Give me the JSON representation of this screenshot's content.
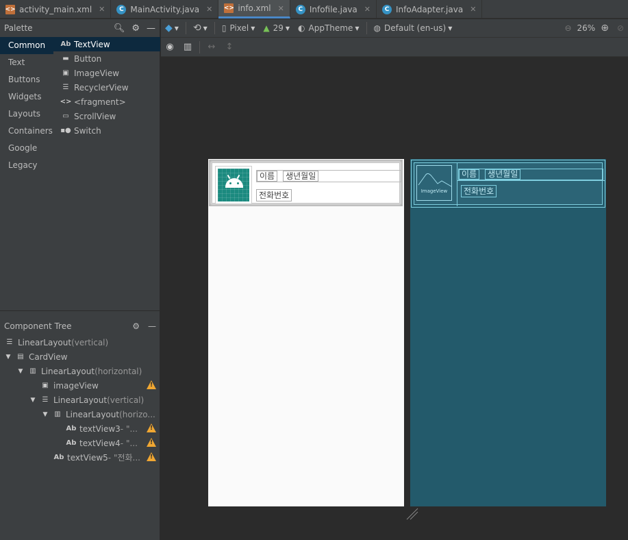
{
  "tabs": [
    {
      "label": "activity_main.xml",
      "kind": "xml",
      "active": false
    },
    {
      "label": "MainActivity.java",
      "kind": "java",
      "active": false
    },
    {
      "label": "info.xml",
      "kind": "xml",
      "active": true
    },
    {
      "label": "Infofile.java",
      "kind": "java",
      "active": false
    },
    {
      "label": "InfoAdapter.java",
      "kind": "java",
      "active": false
    }
  ],
  "palette": {
    "title": "Palette",
    "categories": [
      "Common",
      "Text",
      "Buttons",
      "Widgets",
      "Layouts",
      "Containers",
      "Google",
      "Legacy"
    ],
    "widgets": [
      {
        "icon": "Ab",
        "label": "TextView"
      },
      {
        "icon": "button-icon",
        "label": "Button"
      },
      {
        "icon": "image-icon",
        "label": "ImageView"
      },
      {
        "icon": "list-icon",
        "label": "RecyclerView"
      },
      {
        "icon": "code-icon",
        "label": "<fragment>"
      },
      {
        "icon": "scroll-icon",
        "label": "ScrollView"
      },
      {
        "icon": "switch-icon",
        "label": "Switch"
      }
    ]
  },
  "component_tree": {
    "title": "Component Tree",
    "nodes": [
      {
        "label": "LinearLayout",
        "extra": "(vertical)",
        "warn": false
      },
      {
        "label": "CardView",
        "extra": "",
        "warn": false
      },
      {
        "label": "LinearLayout",
        "extra": "(horizontal)",
        "warn": false
      },
      {
        "label": "imageView",
        "extra": "",
        "warn": true
      },
      {
        "label": "LinearLayout",
        "extra": "(vertical)",
        "warn": false
      },
      {
        "label": "LinearLayout",
        "extra": "(horizo...",
        "warn": false
      },
      {
        "label": "textView3",
        "extra": "- \"...",
        "warn": true
      },
      {
        "label": "textView4",
        "extra": "- \"...",
        "warn": true
      },
      {
        "label": "textView5",
        "extra": "- \"전화...",
        "warn": true
      }
    ]
  },
  "toolbar": {
    "device": "Pixel",
    "api": "29",
    "theme": "AppTheme",
    "locale": "Default (en-us)",
    "zoom": "26%"
  },
  "preview": {
    "name_label": "이름",
    "birth_label": "생년월일",
    "phone_label": "전화번호",
    "imageview_label": "ImageView"
  },
  "colors": {
    "accent": "#4a88c7",
    "blueprint_bg": "#235a6b",
    "warning": "#f0a732"
  }
}
